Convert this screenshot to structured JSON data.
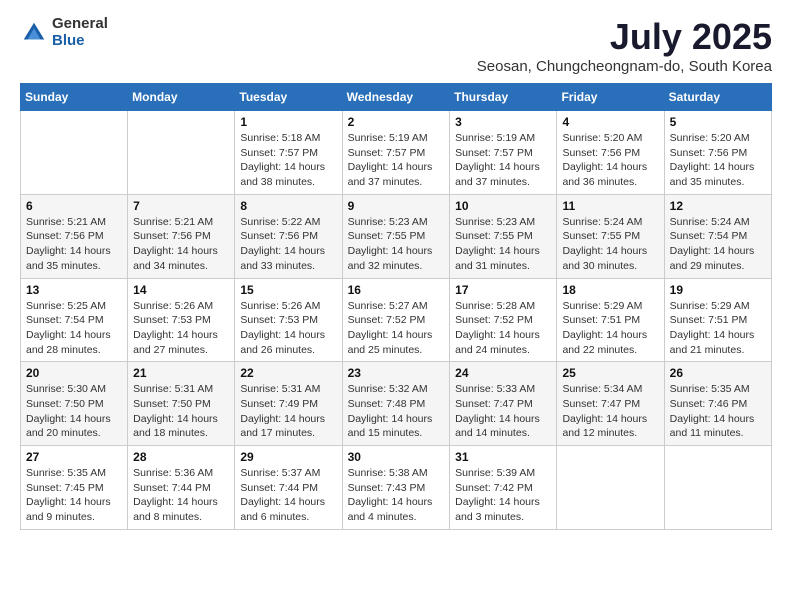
{
  "logo": {
    "general": "General",
    "blue": "Blue"
  },
  "title": "July 2025",
  "subtitle": "Seosan, Chungcheongnam-do, South Korea",
  "days_header": [
    "Sunday",
    "Monday",
    "Tuesday",
    "Wednesday",
    "Thursday",
    "Friday",
    "Saturday"
  ],
  "weeks": [
    [
      {
        "day": "",
        "info": ""
      },
      {
        "day": "",
        "info": ""
      },
      {
        "day": "1",
        "info": "Sunrise: 5:18 AM\nSunset: 7:57 PM\nDaylight: 14 hours and 38 minutes."
      },
      {
        "day": "2",
        "info": "Sunrise: 5:19 AM\nSunset: 7:57 PM\nDaylight: 14 hours and 37 minutes."
      },
      {
        "day": "3",
        "info": "Sunrise: 5:19 AM\nSunset: 7:57 PM\nDaylight: 14 hours and 37 minutes."
      },
      {
        "day": "4",
        "info": "Sunrise: 5:20 AM\nSunset: 7:56 PM\nDaylight: 14 hours and 36 minutes."
      },
      {
        "day": "5",
        "info": "Sunrise: 5:20 AM\nSunset: 7:56 PM\nDaylight: 14 hours and 35 minutes."
      }
    ],
    [
      {
        "day": "6",
        "info": "Sunrise: 5:21 AM\nSunset: 7:56 PM\nDaylight: 14 hours and 35 minutes."
      },
      {
        "day": "7",
        "info": "Sunrise: 5:21 AM\nSunset: 7:56 PM\nDaylight: 14 hours and 34 minutes."
      },
      {
        "day": "8",
        "info": "Sunrise: 5:22 AM\nSunset: 7:56 PM\nDaylight: 14 hours and 33 minutes."
      },
      {
        "day": "9",
        "info": "Sunrise: 5:23 AM\nSunset: 7:55 PM\nDaylight: 14 hours and 32 minutes."
      },
      {
        "day": "10",
        "info": "Sunrise: 5:23 AM\nSunset: 7:55 PM\nDaylight: 14 hours and 31 minutes."
      },
      {
        "day": "11",
        "info": "Sunrise: 5:24 AM\nSunset: 7:55 PM\nDaylight: 14 hours and 30 minutes."
      },
      {
        "day": "12",
        "info": "Sunrise: 5:24 AM\nSunset: 7:54 PM\nDaylight: 14 hours and 29 minutes."
      }
    ],
    [
      {
        "day": "13",
        "info": "Sunrise: 5:25 AM\nSunset: 7:54 PM\nDaylight: 14 hours and 28 minutes."
      },
      {
        "day": "14",
        "info": "Sunrise: 5:26 AM\nSunset: 7:53 PM\nDaylight: 14 hours and 27 minutes."
      },
      {
        "day": "15",
        "info": "Sunrise: 5:26 AM\nSunset: 7:53 PM\nDaylight: 14 hours and 26 minutes."
      },
      {
        "day": "16",
        "info": "Sunrise: 5:27 AM\nSunset: 7:52 PM\nDaylight: 14 hours and 25 minutes."
      },
      {
        "day": "17",
        "info": "Sunrise: 5:28 AM\nSunset: 7:52 PM\nDaylight: 14 hours and 24 minutes."
      },
      {
        "day": "18",
        "info": "Sunrise: 5:29 AM\nSunset: 7:51 PM\nDaylight: 14 hours and 22 minutes."
      },
      {
        "day": "19",
        "info": "Sunrise: 5:29 AM\nSunset: 7:51 PM\nDaylight: 14 hours and 21 minutes."
      }
    ],
    [
      {
        "day": "20",
        "info": "Sunrise: 5:30 AM\nSunset: 7:50 PM\nDaylight: 14 hours and 20 minutes."
      },
      {
        "day": "21",
        "info": "Sunrise: 5:31 AM\nSunset: 7:50 PM\nDaylight: 14 hours and 18 minutes."
      },
      {
        "day": "22",
        "info": "Sunrise: 5:31 AM\nSunset: 7:49 PM\nDaylight: 14 hours and 17 minutes."
      },
      {
        "day": "23",
        "info": "Sunrise: 5:32 AM\nSunset: 7:48 PM\nDaylight: 14 hours and 15 minutes."
      },
      {
        "day": "24",
        "info": "Sunrise: 5:33 AM\nSunset: 7:47 PM\nDaylight: 14 hours and 14 minutes."
      },
      {
        "day": "25",
        "info": "Sunrise: 5:34 AM\nSunset: 7:47 PM\nDaylight: 14 hours and 12 minutes."
      },
      {
        "day": "26",
        "info": "Sunrise: 5:35 AM\nSunset: 7:46 PM\nDaylight: 14 hours and 11 minutes."
      }
    ],
    [
      {
        "day": "27",
        "info": "Sunrise: 5:35 AM\nSunset: 7:45 PM\nDaylight: 14 hours and 9 minutes."
      },
      {
        "day": "28",
        "info": "Sunrise: 5:36 AM\nSunset: 7:44 PM\nDaylight: 14 hours and 8 minutes."
      },
      {
        "day": "29",
        "info": "Sunrise: 5:37 AM\nSunset: 7:44 PM\nDaylight: 14 hours and 6 minutes."
      },
      {
        "day": "30",
        "info": "Sunrise: 5:38 AM\nSunset: 7:43 PM\nDaylight: 14 hours and 4 minutes."
      },
      {
        "day": "31",
        "info": "Sunrise: 5:39 AM\nSunset: 7:42 PM\nDaylight: 14 hours and 3 minutes."
      },
      {
        "day": "",
        "info": ""
      },
      {
        "day": "",
        "info": ""
      }
    ]
  ]
}
